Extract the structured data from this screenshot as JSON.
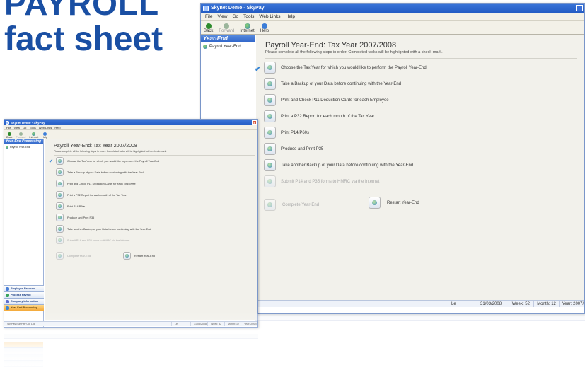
{
  "headline": {
    "line1": "PAYROLL",
    "line2": "fact sheet"
  },
  "app": {
    "title": "Skynet Demo - SkyPay",
    "menu": [
      "File",
      "View",
      "Go",
      "Tools",
      "Web Links",
      "Help"
    ],
    "toolbar": {
      "back": "Back",
      "forward": "Forward",
      "internet": "Internet",
      "help": "Help"
    },
    "sidebar": {
      "header": "Year-End Processing",
      "item": "Payroll Year-End"
    },
    "content": {
      "title": "Payroll Year-End: Tax Year 2007/2008",
      "subtitle": "Please complete all the following steps in order. Completed tasks will be highlighted with a check-mark.",
      "tasks": [
        "Choose the Tax Year for which you would like to perform the Payroll Year-End",
        "Take a Backup of your Data before continuing with the Year-End",
        "Print and Check P11 Deduction Cards for each Employee",
        "Print a P32 Report for each month of the Tax Year",
        "Print P14/P60s",
        "Produce and Print P35",
        "Take another Backup of your Data before continuing with the Year-End",
        "Submit P14 and P35 forms to HMRC via the Internet"
      ],
      "complete": "Complete Year-End",
      "restart": "Restart Year-End",
      "check": "✔"
    },
    "nav": [
      "Employee Records",
      "Process Payroll",
      "Company Information",
      "Year-End Processing"
    ],
    "status": {
      "c1": "SkyPay /SkyPay Co. Ltd.",
      "c2": "Le",
      "date": "31/03/2008",
      "week": "Week: 52",
      "month": "Month: 12",
      "year": "Year: 2007/2008"
    }
  }
}
